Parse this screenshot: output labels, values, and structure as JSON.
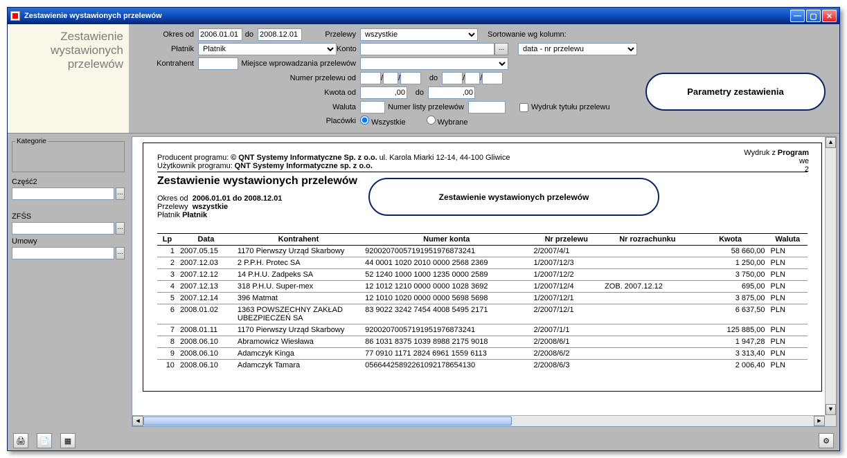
{
  "window_title": "Zestawienie wystawionych przelewów",
  "left_title_l1": "Zestawienie",
  "left_title_l2": "wystawionych",
  "left_title_l3": "przelewów",
  "filters": {
    "okres_od_label": "Okres od",
    "okres_od": "2006.01.01",
    "do_label": "do",
    "okres_do": "2008.12.01",
    "przelewy_label": "Przelewy",
    "przelewy_value": "wszystkie",
    "sort_label": "Sortowanie wg kolumn:",
    "sort_value": "data - nr przelewu",
    "platnik_label": "Płatnik",
    "platnik_value": "Platnik",
    "konto_label": "Konto",
    "kontrahent_label": "Kontrahent",
    "miejsce_label": "Miejsce wprowadzania przelewów",
    "numer_od_label": "Numer przelewu od",
    "kwota_od_label": "Kwota od",
    "kwota_od": ",00",
    "kwota_do": ",00",
    "waluta_label": "Waluta",
    "lista_label": "Numer listy przelewów",
    "wydruk_label": "Wydruk tytułu przelewu",
    "placowki_label": "Placówki",
    "placowki_all": "Wszystkie",
    "placowki_sel": "Wybrane",
    "slash": "/"
  },
  "bubble_params": "Parametry zestawienia",
  "side": {
    "kategorie": "Kategorie",
    "czesc2": "Część2",
    "zfss": "ZFŚS",
    "umowy": "Umowy"
  },
  "report": {
    "producent_label": "Producent programu:",
    "producent": "© QNT Systemy Informatyczne Sp. z o.o.",
    "addr": "ul. Karola Miarki 12-14, 44-100 Gliwice",
    "uzytk_label": "Użytkownik programu:",
    "uzytk": "QNT Systemy Informatyczne sp. z o.o.",
    "wydruk_z": "Wydruk z",
    "program": "Program",
    "we": "we",
    "page": "2",
    "title": "Zestawienie wystawionych przelewów",
    "bubble": "Zestawienie wystawionych przelewów",
    "okres_label": "Okres od",
    "okres": "2006.01.01 do 2008.12.01",
    "przelewy_label": "Przelewy",
    "przelewy": "wszystkie",
    "platnik_label": "Płatnik",
    "platnik": "Płatnik",
    "cols": [
      "Lp",
      "Data",
      "Kontrahent",
      "Numer konta",
      "Nr przelewu",
      "Nr rozrachunku",
      "Kwota",
      "Waluta"
    ],
    "rows": [
      {
        "lp": "1",
        "data": "2007.05.15",
        "k": "1170 Pierwszy Urząd Skarbowy",
        "nk": "92002070057191951976873241",
        "np": "2/2007/4/1",
        "nr": "",
        "kw": "58 660,00",
        "w": "PLN"
      },
      {
        "lp": "2",
        "data": "2007.12.03",
        "k": "2 P.P.H. Protec SA",
        "nk": "44 0001 1020 2010 0000 2568 2369",
        "np": "1/2007/12/3",
        "nr": "",
        "kw": "1 250,00",
        "w": "PLN"
      },
      {
        "lp": "3",
        "data": "2007.12.12",
        "k": "14 P.H.U. Zadpeks SA",
        "nk": "52 1240 1000 1000 1235 0000 2589",
        "np": "1/2007/12/2",
        "nr": "",
        "kw": "3 750,00",
        "w": "PLN"
      },
      {
        "lp": "4",
        "data": "2007.12.13",
        "k": "318 P.H.U. Super-mex",
        "nk": "12 1012 1210 0000 0000 1028 3692",
        "np": "1/2007/12/4",
        "nr": "ZOB. 2007.12.12",
        "kw": "695,00",
        "w": "PLN"
      },
      {
        "lp": "5",
        "data": "2007.12.14",
        "k": "396 Matmat",
        "nk": "12 1010 1020 0000 0000 5698 5698",
        "np": "1/2007/12/1",
        "nr": "",
        "kw": "3 875,00",
        "w": "PLN"
      },
      {
        "lp": "6",
        "data": "2008.01.02",
        "k": "1363 POWSZECHNY ZAKŁAD UBEZPIECZEŃ SA",
        "nk": "83 9022 3242 7454 4008 5495 2171",
        "np": "2/2007/12/1",
        "nr": "",
        "kw": "6 637,50",
        "w": "PLN"
      },
      {
        "lp": "7",
        "data": "2008.01.11",
        "k": "1170 Pierwszy Urząd Skarbowy",
        "nk": "92002070057191951976873241",
        "np": "2/2007/1/1",
        "nr": "",
        "kw": "125 885,00",
        "w": "PLN"
      },
      {
        "lp": "8",
        "data": "2008.06.10",
        "k": "Abramowicz Wiesława",
        "nk": "86 1031 8375 1039 8988 2175 9018",
        "np": "2/2008/6/1",
        "nr": "",
        "kw": "1 947,28",
        "w": "PLN"
      },
      {
        "lp": "9",
        "data": "2008.06.10",
        "k": "Adamczyk Kinga",
        "nk": "77 0910 1171 2824 6961 1559 6113",
        "np": "2/2008/6/2",
        "nr": "",
        "kw": "3 313,40",
        "w": "PLN"
      },
      {
        "lp": "10",
        "data": "2008.06.10",
        "k": "Adamczyk Tamara",
        "nk": "05664425892261092178654130",
        "np": "2/2008/6/3",
        "nr": "",
        "kw": "2 006,40",
        "w": "PLN"
      }
    ]
  }
}
